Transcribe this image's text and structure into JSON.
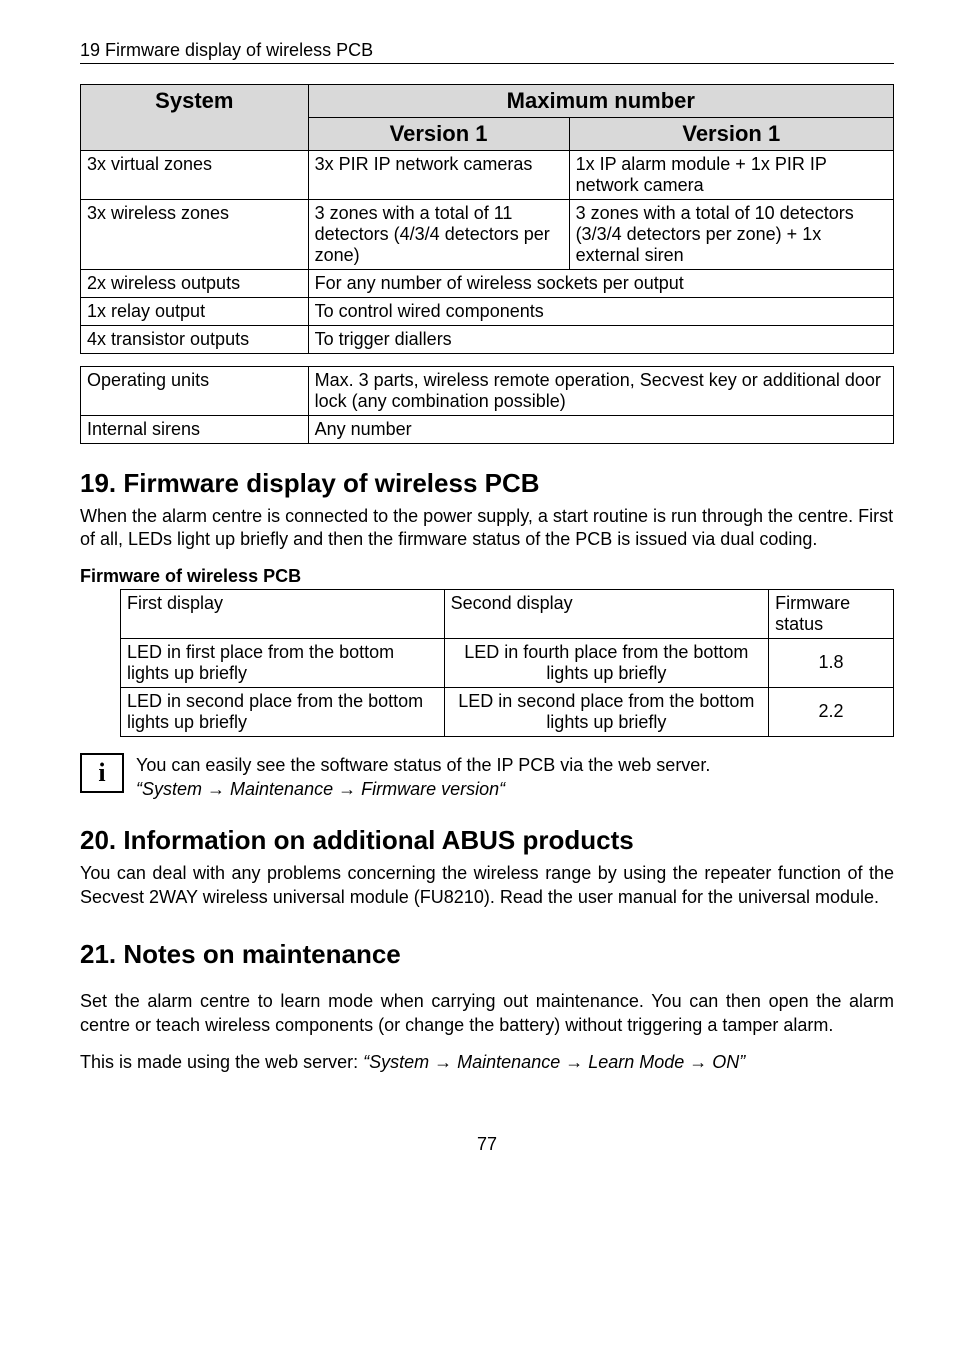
{
  "header": "19  Firmware display of wireless PCB",
  "table1": {
    "head": {
      "system": "System",
      "max": "Maximum number",
      "v1a": "Version 1",
      "v1b": "Version 1"
    },
    "rows": [
      {
        "c1": "3x virtual zones",
        "c2": "3x PIR IP network cameras",
        "c3": "1x IP alarm module + 1x PIR IP network camera"
      },
      {
        "c1": "3x wireless zones",
        "c2": "3 zones with a total of 11 detectors (4/3/4 detectors per zone)",
        "c3": "3 zones with a total of 10 detectors (3/3/4 detectors per zone) + 1x external siren"
      },
      {
        "c1": "2x wireless outputs",
        "span": "For any number of wireless sockets per output"
      },
      {
        "c1": "1x relay output",
        "span": "To control wired components"
      },
      {
        "c1": "4x transistor outputs",
        "span": "To trigger diallers"
      }
    ]
  },
  "table2": {
    "rows": [
      {
        "c1": "Operating units",
        "c2": "Max. 3 parts, wireless remote operation, Secvest key or additional door lock (any combination possible)"
      },
      {
        "c1": "Internal sirens",
        "c2": "Any number"
      }
    ]
  },
  "section19": {
    "title": "19. Firmware display of wireless PCB",
    "body": "When the alarm centre is connected to the power supply, a start routine is run through the centre. First of all, LEDs light up briefly and then the firmware status of the PCB is issued via dual coding.",
    "sub": "Firmware of wireless PCB",
    "fw_table": {
      "head": {
        "c1": "First display",
        "c2": "Second display",
        "c3": "Firmware status"
      },
      "rows": [
        {
          "c1": "LED in first place from the bottom lights up briefly",
          "c2": "LED in fourth place from the bottom lights up briefly",
          "c3": "1.8"
        },
        {
          "c1": "LED in second place from the bottom lights up briefly",
          "c2": "LED in second place from the bottom lights up briefly",
          "c3": "2.2"
        }
      ]
    },
    "info": {
      "line1": "You can easily see the software status of the IP PCB via the web server.",
      "line2_pre": "“System ",
      "arrow": "→",
      "line2_mid1": " Maintenance ",
      "line2_mid2": " Firmware version“"
    }
  },
  "section20": {
    "title": "20. Information on additional ABUS products",
    "body": "You can deal with any problems concerning the wireless range by using the repeater function of the Secvest 2WAY wireless universal module (FU8210). Read the user manual for the universal module."
  },
  "section21": {
    "title": "21. Notes on maintenance",
    "body1": "Set the alarm centre to learn mode when carrying out maintenance. You can then open the alarm centre or teach wireless components (or change the battery) without triggering a tamper alarm.",
    "body2_pre": "This is made using the web server: ",
    "body2_italic_pre": "“System ",
    "arrow": "→",
    "body2_m1": " Maintenance ",
    "body2_m2": " Learn Mode ",
    "body2_end": " ON”"
  },
  "chart_data": {
    "type": "table",
    "tables": [
      {
        "title": "Maximum number",
        "columns": [
          "System",
          "Version 1",
          "Version 1"
        ],
        "rows": [
          [
            "3x virtual zones",
            "3x PIR IP network cameras",
            "1x IP alarm module + 1x PIR IP network camera"
          ],
          [
            "3x wireless zones",
            "3 zones with a total of 11 detectors (4/3/4 detectors per zone)",
            "3 zones with a total of 10 detectors (3/3/4 detectors per zone) + 1x external siren"
          ],
          [
            "2x wireless outputs",
            "For any number of wireless sockets per output",
            ""
          ],
          [
            "1x relay output",
            "To control wired components",
            ""
          ],
          [
            "4x transistor outputs",
            "To trigger diallers",
            ""
          ]
        ]
      },
      {
        "columns": [
          "",
          ""
        ],
        "rows": [
          [
            "Operating units",
            "Max. 3 parts, wireless remote operation, Secvest key or additional door lock (any combination possible)"
          ],
          [
            "Internal sirens",
            "Any number"
          ]
        ]
      },
      {
        "title": "Firmware of wireless PCB",
        "columns": [
          "First display",
          "Second display",
          "Firmware status"
        ],
        "rows": [
          [
            "LED in first place from the bottom lights up briefly",
            "LED in fourth place from the bottom lights up briefly",
            "1.8"
          ],
          [
            "LED in second place from the bottom lights up briefly",
            "LED in second place from the bottom lights up briefly",
            "2.2"
          ]
        ]
      }
    ]
  },
  "page": "77"
}
